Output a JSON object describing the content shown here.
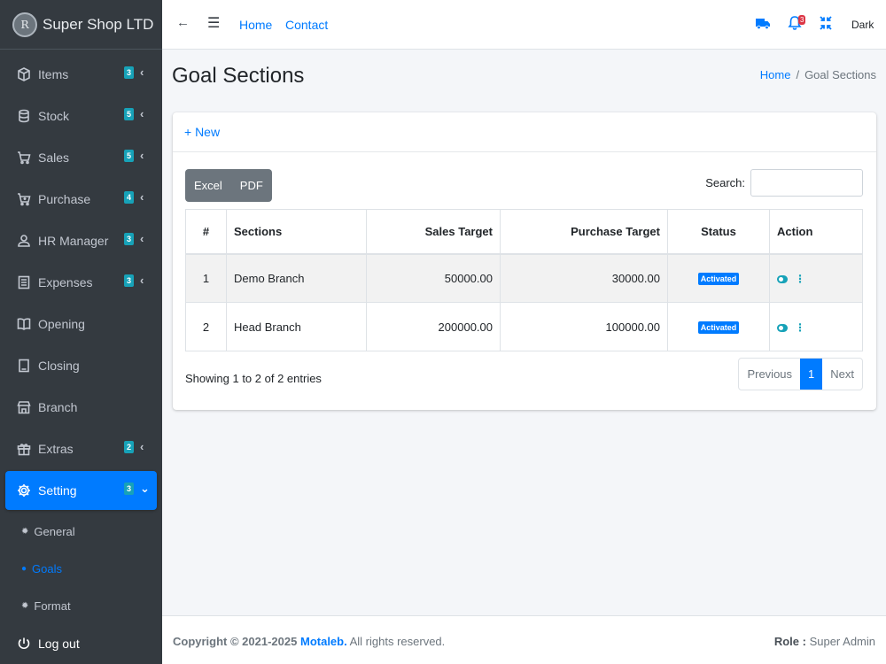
{
  "brand": {
    "name": "Super Shop LTD",
    "logo_glyph": "R"
  },
  "sidebar": {
    "items": [
      {
        "label": "Items",
        "badge": "3",
        "icon": "box-icon"
      },
      {
        "label": "Stock",
        "badge": "5",
        "icon": "database-icon"
      },
      {
        "label": "Sales",
        "badge": "5",
        "icon": "cart-icon"
      },
      {
        "label": "Purchase",
        "badge": "4",
        "icon": "cart-plus-icon"
      },
      {
        "label": "HR Manager",
        "badge": "3",
        "icon": "user-icon"
      },
      {
        "label": "Expenses",
        "badge": "3",
        "icon": "receipt-icon"
      },
      {
        "label": "Opening",
        "icon": "book-open-icon"
      },
      {
        "label": "Closing",
        "icon": "book-icon"
      },
      {
        "label": "Branch",
        "icon": "store-icon"
      },
      {
        "label": "Extras",
        "badge": "2",
        "icon": "gift-icon"
      },
      {
        "label": "Setting",
        "badge": "3",
        "icon": "gear-icon"
      }
    ],
    "sub_items": [
      {
        "label": "General"
      },
      {
        "label": "Goals"
      },
      {
        "label": "Format"
      }
    ],
    "logout": "Log out",
    "colors": {
      "bg": "#343a40",
      "active": "#007bff",
      "badge": "#17a2b8"
    }
  },
  "navbar": {
    "links": [
      "Home",
      "Contact"
    ],
    "notification_count": "3",
    "theme_label": "Dark"
  },
  "page": {
    "title": "Goal Sections"
  },
  "breadcrumb": {
    "home": "Home",
    "current": "Goal Sections"
  },
  "card": {
    "new_label": "+ New",
    "export_buttons": [
      "Excel",
      "PDF"
    ],
    "search_label": "Search:",
    "search_value": ""
  },
  "table": {
    "headers": [
      "#",
      "Sections",
      "Sales Target",
      "Purchase Target",
      "Status",
      "Action"
    ],
    "rows": [
      {
        "num": "1",
        "section": "Demo Branch",
        "sales": "50000.00",
        "purchase": "30000.00",
        "status": "Activated"
      },
      {
        "num": "2",
        "section": "Head Branch",
        "sales": "200000.00",
        "purchase": "100000.00",
        "status": "Activated"
      }
    ]
  },
  "info": "Showing 1 to 2 of 2 entries",
  "pagination": {
    "prev": "Previous",
    "current": "1",
    "next": "Next"
  },
  "footer": {
    "copyright": "Copyright © 2021-2025",
    "brand": "Motaleb.",
    "rights": "All rights reserved.",
    "role_label": "Role :",
    "role_value": "Super Admin"
  }
}
